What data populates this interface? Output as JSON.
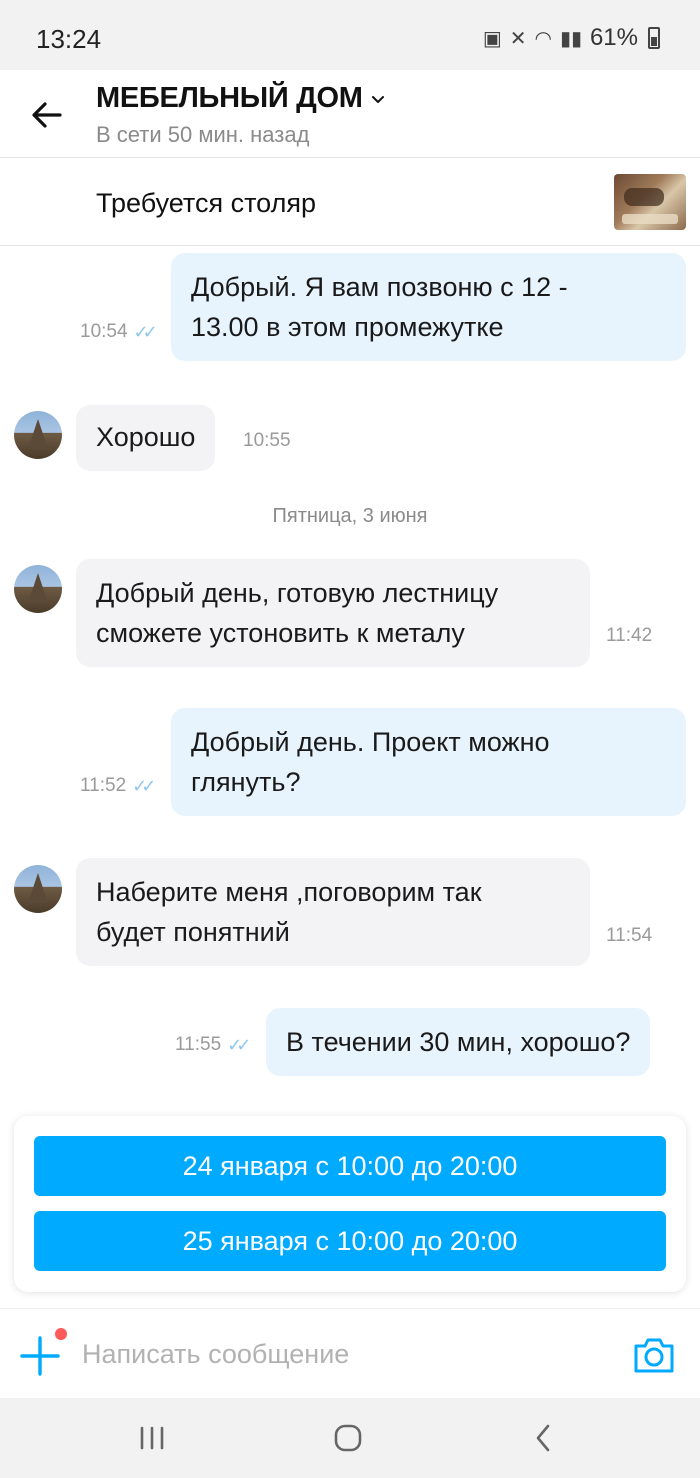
{
  "status_bar": {
    "time": "13:24",
    "battery": "61%"
  },
  "header": {
    "title": "МЕБЕЛЬНЫЙ ДОМ",
    "status": "В сети 50 мин. назад"
  },
  "listing": {
    "title": "Требуется столяр"
  },
  "messages": [
    {
      "direction": "out",
      "lines": [
        "Добрый. Я вам позвоню с 12 -",
        "13.00 в этом промежутке"
      ],
      "time": "10:54",
      "read": true
    },
    {
      "direction": "in",
      "lines": [
        "Хорошо"
      ],
      "time": "10:55"
    },
    {
      "direction": "in",
      "lines": [
        "Добрый день, готовую лестницу",
        "сможете устоновить к металу"
      ],
      "time": "11:42"
    },
    {
      "direction": "out",
      "lines": [
        "Добрый день. Проект можно",
        "глянуть?"
      ],
      "time": "11:52",
      "read": true
    },
    {
      "direction": "in",
      "lines": [
        "Наберите меня ,поговорим так",
        "будет понятний"
      ],
      "time": "11:54"
    },
    {
      "direction": "out",
      "lines": [
        "В течении 30 мин, хорошо?"
      ],
      "time": "11:55",
      "read": true
    }
  ],
  "date_separator": "Пятница, 3 июня",
  "slots": [
    "24 января с 10:00 до 20:00",
    "25 января с 10:00 до 20:00"
  ],
  "composer": {
    "placeholder": "Написать сообщение"
  },
  "colors": {
    "accent": "#00aaff",
    "outgoing_bubble": "#e8f4fd",
    "incoming_bubble": "#f3f3f5",
    "notification_dot": "#ff5a5a"
  }
}
